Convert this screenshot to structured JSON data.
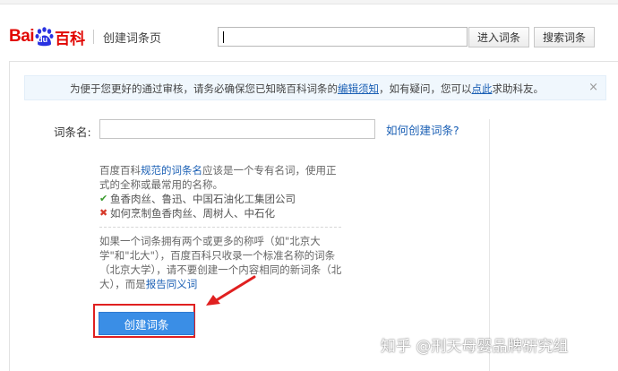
{
  "header": {
    "logo": {
      "bai": "Bai",
      "du": "du",
      "baike": "百科"
    },
    "page_name": "创建词条页",
    "search_value": "",
    "enter_button": "进入词条",
    "search_button": "搜索词条"
  },
  "notice": {
    "text_before": "为便于您更好的通过审核，请务必确保您已知晓百科词条的",
    "link1": "编辑须知",
    "text_middle": "，如有疑问，您可以",
    "link2": "点此",
    "text_after": "求助科友。",
    "close": "×"
  },
  "form": {
    "name_label": "词条名:",
    "name_value": "",
    "how_link": "如何创建词条?"
  },
  "tips": {
    "intro_before": "百度百科",
    "intro_link": "规范的词条名",
    "intro_after": "应该是一个专有名词，使用正式的全称或最常用的名称。",
    "good_example": "鱼香肉丝、鲁迅、中国石油化工集团公司",
    "bad_example": "如何烹制鱼香肉丝、周树人、中石化",
    "para2_before": "如果一个词条拥有两个或更多的称呼（如\"北京大学\"和\"北大\"），百度百科只收录一个标准名称的词条（北京大学），请不要创建一个内容相同的新词条（北大），而是",
    "para2_link": "报告同义词"
  },
  "create_button": "创建词条",
  "watermark": "知乎 @刑天母婴品牌研究组",
  "colors": {
    "brand_red": "#e10602",
    "link_blue": "#1a5fb4",
    "button_blue": "#3a8ee6",
    "highlight_red": "#e02020"
  }
}
